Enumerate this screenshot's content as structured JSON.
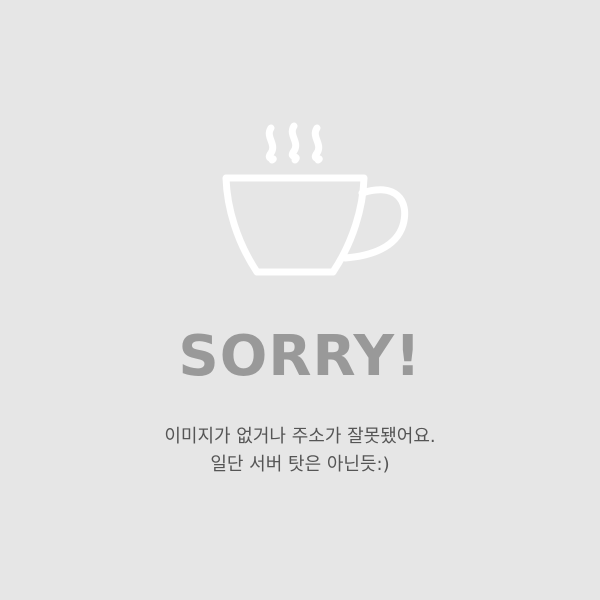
{
  "illustration": {
    "icon": "coffee-cup-icon",
    "color": "#ffffff"
  },
  "title": "SORRY!",
  "message": {
    "line1": "이미지가 없거나 주소가 잘못됐어요.",
    "line2": "일단 서버 탓은 아닌듯:)"
  },
  "colors": {
    "background": "#e6e6e6",
    "title": "#999999",
    "text": "#555555"
  }
}
